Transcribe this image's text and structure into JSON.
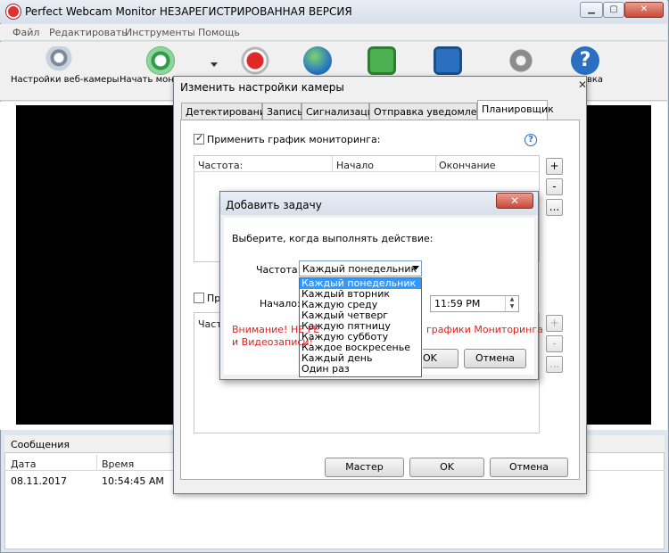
{
  "window": {
    "title": "Perfect Webcam Monitor НЕЗАРЕГИСТРИРОВАННАЯ ВЕРСИЯ"
  },
  "menu": [
    "Файл",
    "Редактировать",
    "Инструменты",
    "Помощь"
  ],
  "toolbar": {
    "webcam_settings": "Настройки веб-камеры",
    "start_monitoring": "Начать мони",
    "help_partial": "вка"
  },
  "messages": {
    "header": "Сообщения",
    "columns": [
      "Дата",
      "Время"
    ],
    "rows": [
      {
        "date": "08.11.2017",
        "time": "10:54:45 AM"
      }
    ]
  },
  "camera_dialog": {
    "title": "Изменить настройки камеры",
    "tabs": [
      "Детектирование",
      "Запись",
      "Сигнализация",
      "Отправка уведомлений",
      "Планировщик"
    ],
    "active_tab": "Планировщик",
    "apply_schedule_label": "Применить график мониторинга:",
    "apply_schedule_checked": true,
    "grid_columns": [
      "Частота:",
      "Начало",
      "Окончание"
    ],
    "second_check_label": "При",
    "second_grid_col": "Часто",
    "side_buttons": [
      "+",
      "-",
      "..."
    ],
    "buttons": {
      "master": "Мастер",
      "ok": "OK",
      "cancel": "Отмена"
    }
  },
  "task_dialog": {
    "title": "Добавить задачу",
    "close": "✕",
    "prompt": "Выберите, когда выполнять действие:",
    "frequency_label": "Частота:",
    "frequency_value": "Каждый понедельник",
    "frequency_options": [
      "Каждый понедельник",
      "Каждый вторник",
      "Каждую среду",
      "Каждый четверг",
      "Каждую пятницу",
      "Каждую субботу",
      "Каждое воскресенье",
      "Каждый день",
      "Один раз"
    ],
    "selected_option": 0,
    "start_label": "Начало:",
    "start_time": "11:59 PM",
    "warning_line1_a": "Внимание! НЕ РЕ",
    "warning_line1_b": "графики Мониторинга",
    "warning_line2": "и Видеозаписи!",
    "ok_label": "OK",
    "cancel_label": "Отмена"
  }
}
